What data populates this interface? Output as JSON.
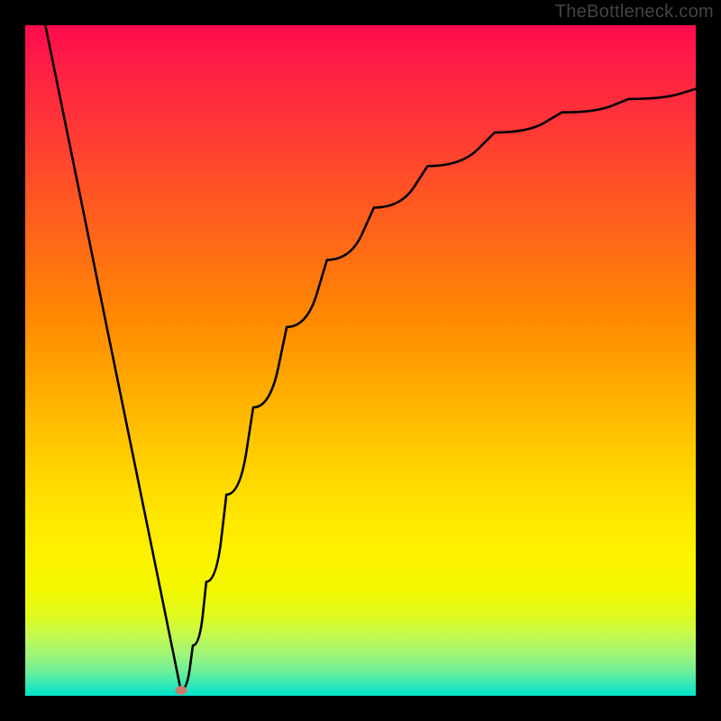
{
  "watermark": "TheBottleneck.com",
  "gradient_colors": {
    "top": "#ff0a4b",
    "mid_upper": "#ff6d14",
    "mid": "#ffd500",
    "lower": "#e0fa1e",
    "bottom": "#00e3cc"
  },
  "dot": {
    "x_frac": 0.232,
    "y_frac": 0.992,
    "color": "#c97a6a"
  },
  "chart_data": {
    "type": "line",
    "title": "",
    "xlabel": "",
    "ylabel": "",
    "xlim": [
      0,
      1
    ],
    "ylim": [
      0,
      1
    ],
    "series": [
      {
        "name": "left-branch",
        "x": [
          0.03,
          0.06,
          0.09,
          0.12,
          0.15,
          0.18,
          0.2,
          0.215,
          0.225,
          0.232
        ],
        "y": [
          1.0,
          0.853,
          0.706,
          0.558,
          0.411,
          0.264,
          0.166,
          0.092,
          0.043,
          0.008
        ]
      },
      {
        "name": "right-branch",
        "x": [
          0.232,
          0.25,
          0.27,
          0.3,
          0.34,
          0.39,
          0.45,
          0.52,
          0.6,
          0.7,
          0.8,
          0.9,
          1.0
        ],
        "y": [
          0.008,
          0.075,
          0.17,
          0.3,
          0.43,
          0.55,
          0.65,
          0.728,
          0.79,
          0.84,
          0.87,
          0.89,
          0.905
        ]
      }
    ],
    "marker": {
      "x": 0.232,
      "y": 0.008
    },
    "background": "vertical-gradient",
    "axes_visible": false,
    "grid": false
  }
}
